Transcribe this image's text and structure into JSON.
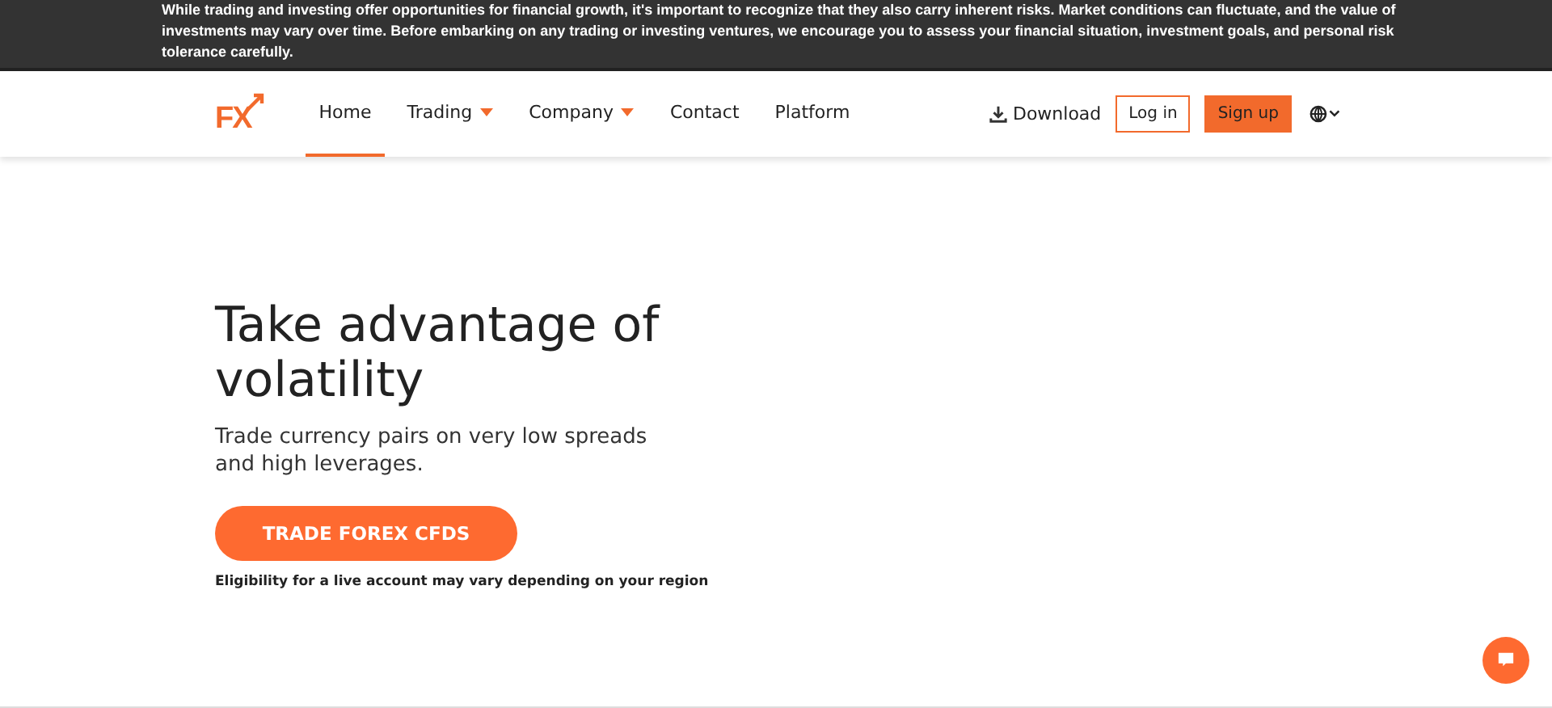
{
  "risk_banner": {
    "text": "While trading and investing offer opportunities for financial growth, it's important to recognize that they also carry inherent risks. Market conditions can fluctuate, and the value of investments may vary over time. Before embarking on any trading or investing ventures, we encourage you to assess your financial situation, investment goals, and personal risk tolerance carefully."
  },
  "header": {
    "logo": "FX",
    "nav": [
      {
        "label": "Home",
        "selected": true,
        "has_dropdown": false
      },
      {
        "label": "Trading",
        "selected": false,
        "has_dropdown": true
      },
      {
        "label": "Company",
        "selected": false,
        "has_dropdown": true
      },
      {
        "label": "Contact",
        "selected": false,
        "has_dropdown": false
      },
      {
        "label": "Platform",
        "selected": false,
        "has_dropdown": false
      }
    ],
    "download": "Download",
    "login": "Log in",
    "signup": "Sign up"
  },
  "hero": {
    "title": "Take advantage of volatility",
    "subtitle": "Trade currency pairs on very low spreads and high leverages.",
    "cta": "TRADE FOREX CFDS",
    "note": "Eligibility for a live account may vary depending on your region"
  }
}
